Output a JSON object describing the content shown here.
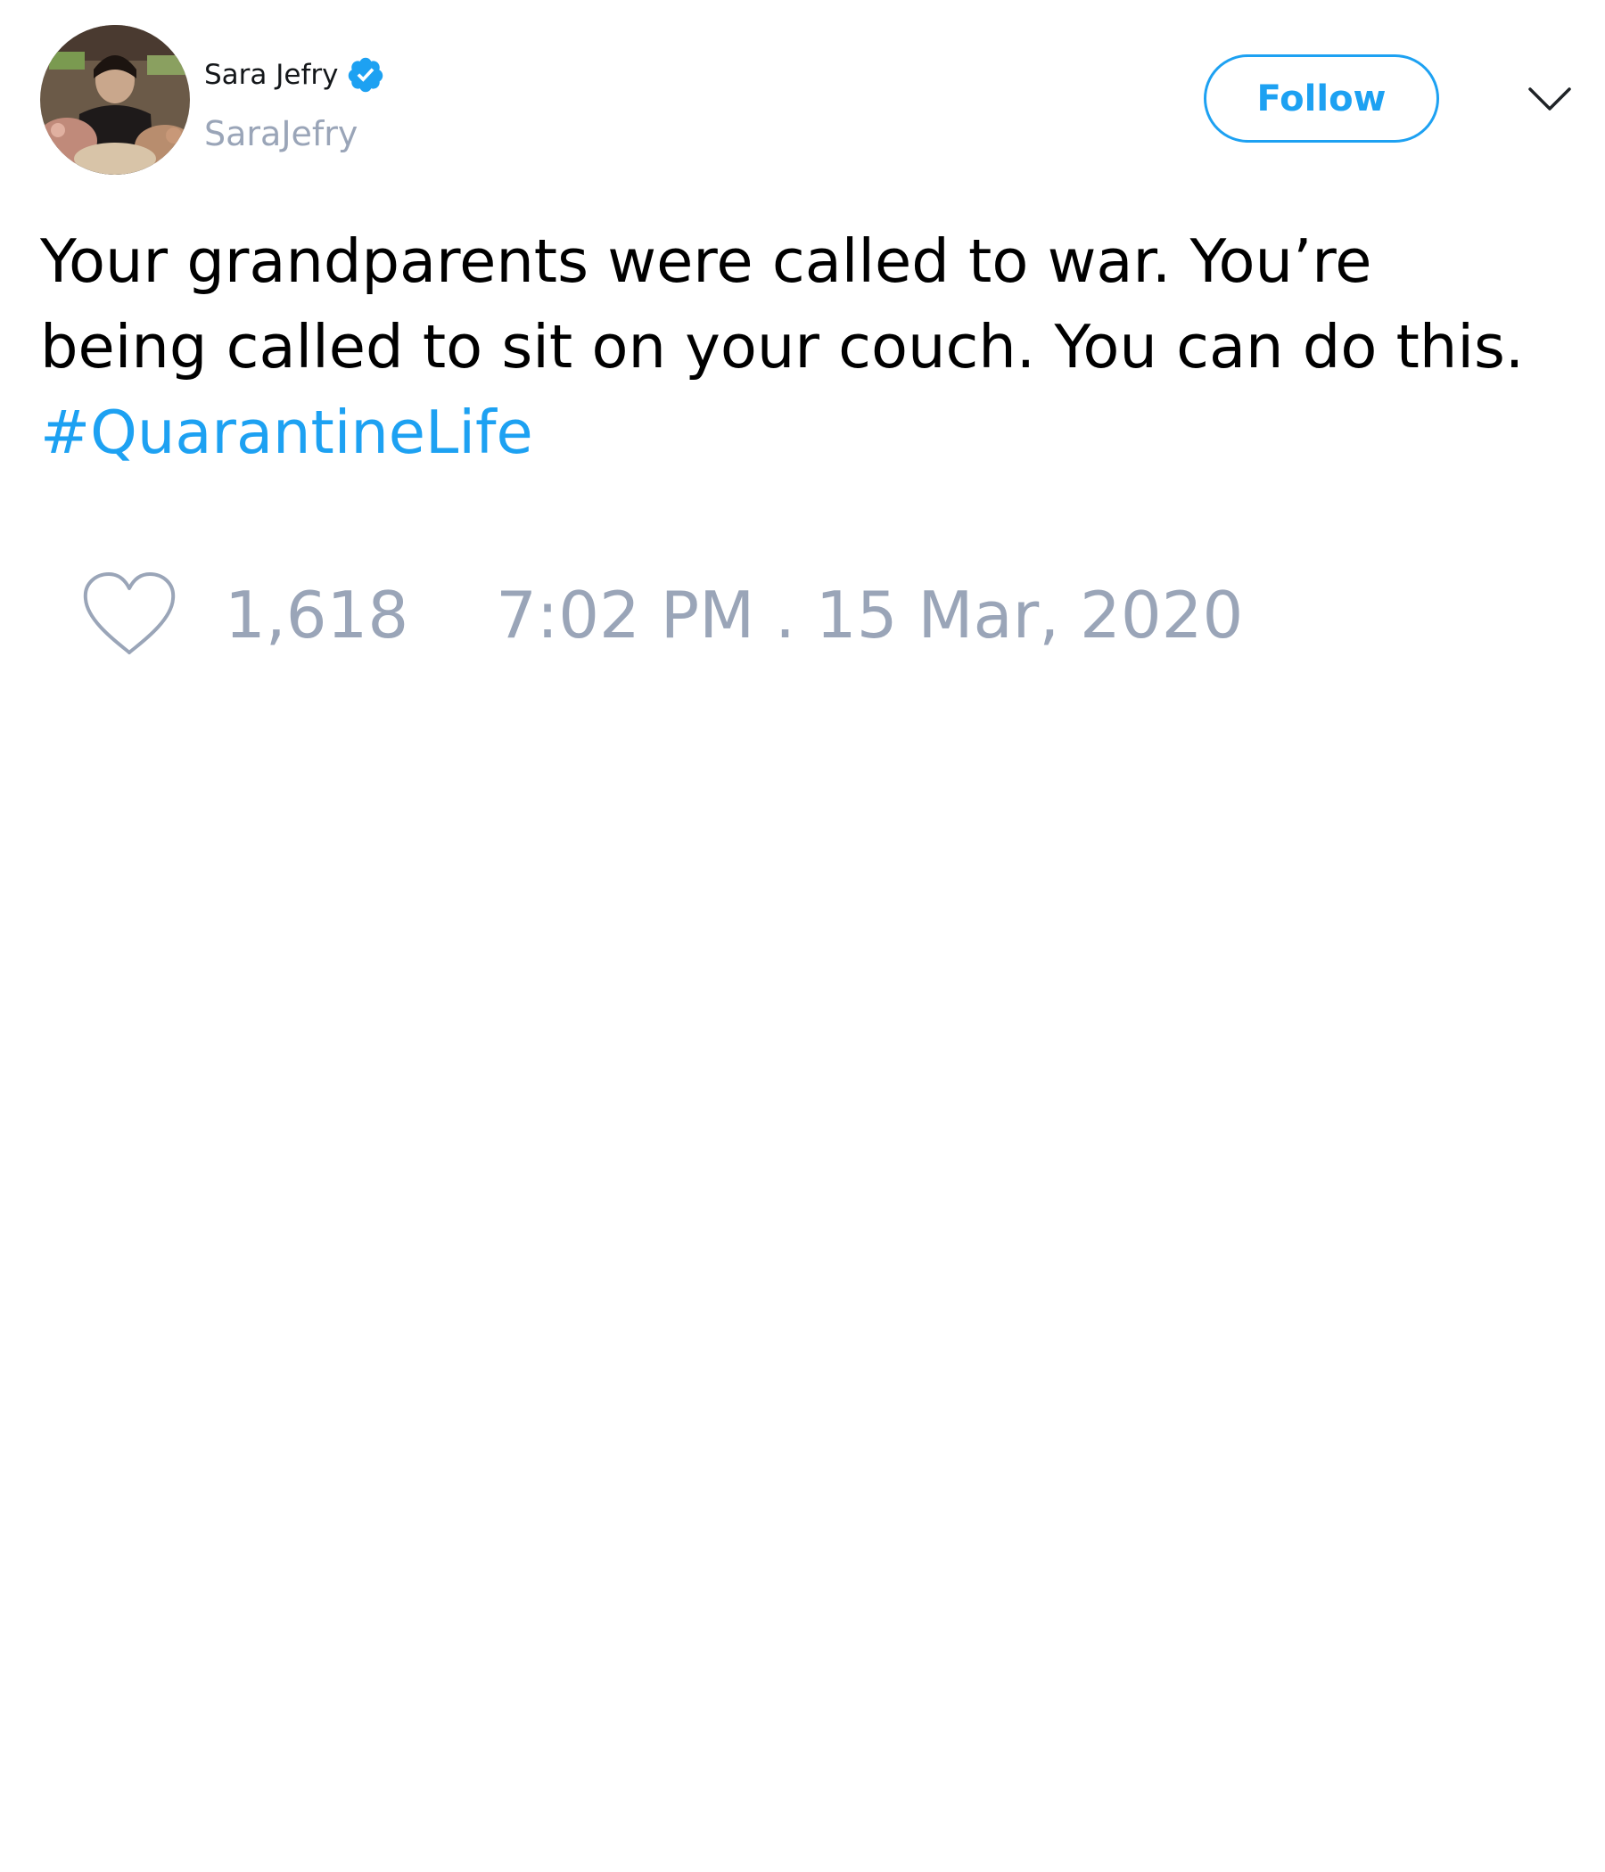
{
  "author": {
    "display_name": "Sara Jefry",
    "handle": "SaraJefry",
    "verified": true,
    "avatar_icon": "profile-photo"
  },
  "header": {
    "follow_label": "Follow",
    "menu_icon": "chevron-down-icon"
  },
  "tweet": {
    "text_line_1": "Your grandparents were called to war. You’re",
    "text_line_2": "being called to sit on your couch. You can do this.",
    "hashtag": "#QuarantineLife"
  },
  "meta": {
    "like_icon": "heart-icon",
    "likes": "1,618",
    "timestamp": "7:02 PM . 15 Mar, 2020"
  },
  "colors": {
    "accent": "#1da1f2",
    "muted": "#9aa5b8",
    "text": "#000000"
  }
}
